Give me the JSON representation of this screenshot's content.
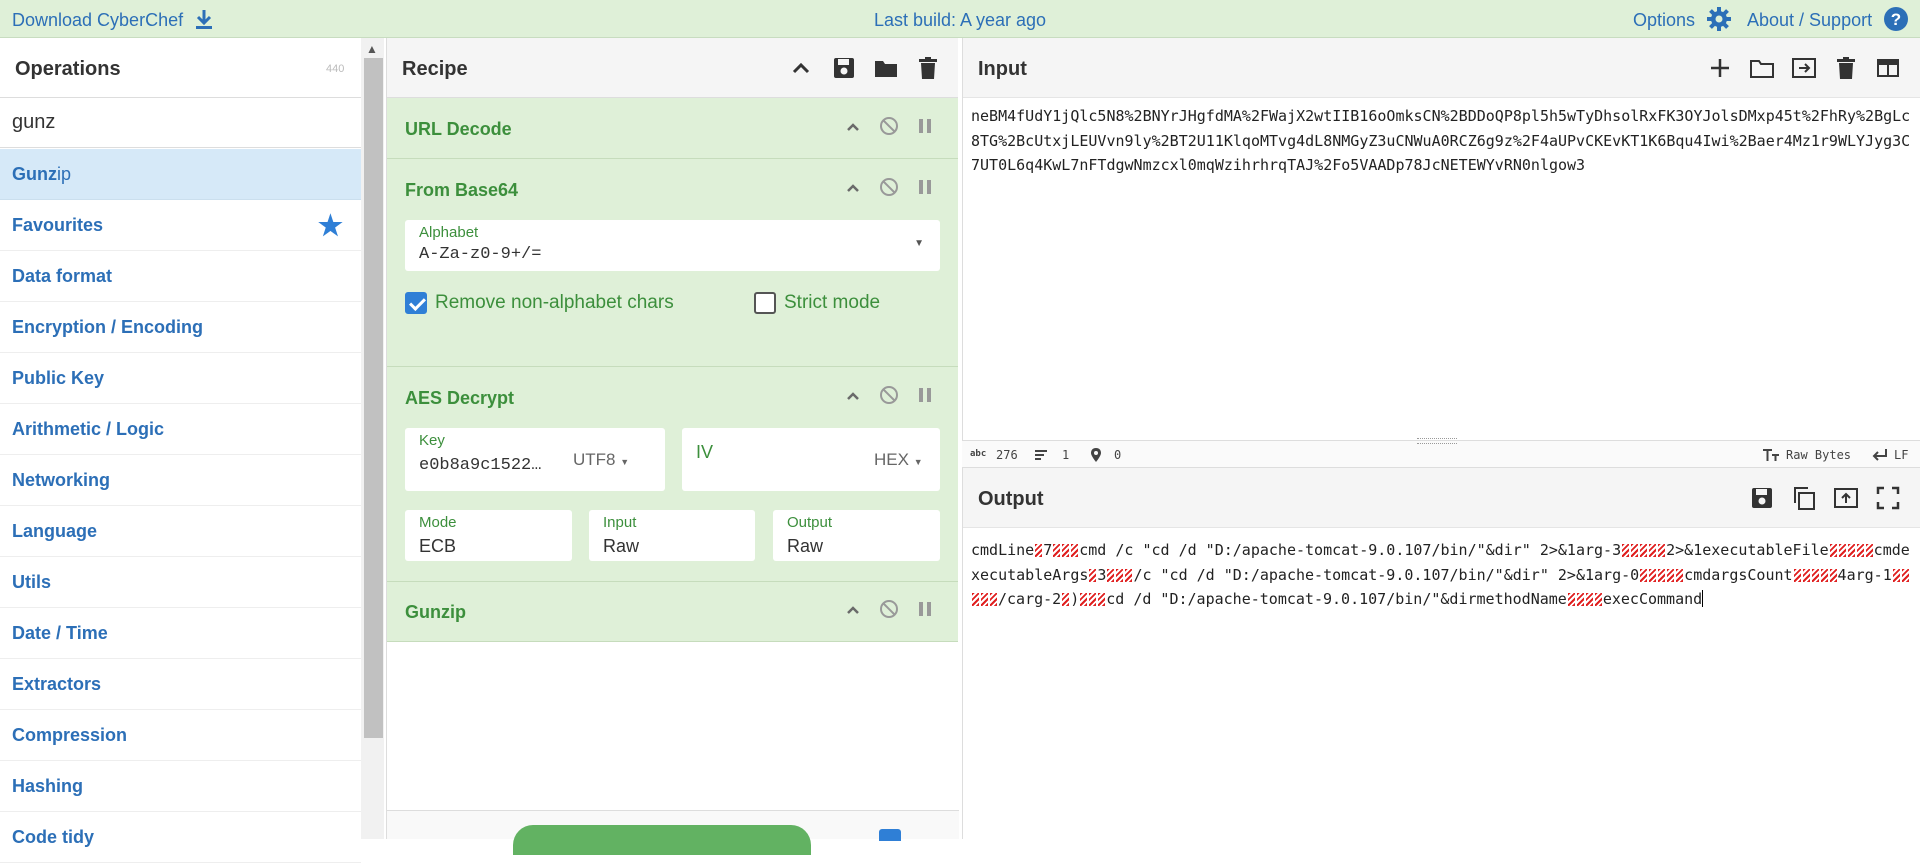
{
  "topbar": {
    "download": "Download CyberChef",
    "last_build": "Last build: A year ago",
    "options": "Options",
    "about": "About / Support"
  },
  "operations": {
    "title": "Operations",
    "count": "440",
    "search_value": "gunz",
    "result_match": "Gunz",
    "result_rest": "ip",
    "categories": [
      "Favourites",
      "Data format",
      "Encryption / Encoding",
      "Public Key",
      "Arithmetic / Logic",
      "Networking",
      "Language",
      "Utils",
      "Date / Time",
      "Extractors",
      "Compression",
      "Hashing",
      "Code tidy"
    ]
  },
  "recipe": {
    "title": "Recipe",
    "url_decode": "URL Decode",
    "from_base64": "From Base64",
    "alphabet_label": "Alphabet",
    "alphabet_value": "A-Za-z0-9+/=",
    "remove_nonalpha": "Remove non-alphabet chars",
    "strict_mode": "Strict mode",
    "aes_decrypt": "AES Decrypt",
    "key_label": "Key",
    "key_value": "e0b8a9c1522…",
    "key_encoding": "UTF8",
    "iv_label": "IV",
    "iv_encoding": "HEX",
    "mode_label": "Mode",
    "mode_value": "ECB",
    "input_label": "Input",
    "input_value": "Raw",
    "output_label": "Output",
    "output_value": "Raw",
    "gunzip": "Gunzip"
  },
  "input": {
    "title": "Input",
    "text": "neBM4fUdY1jQlc5N8%2BNYrJHgfdMA%2FWajX2wtIIB16oOmksCN%2BDDoQP8pl5h5wTyDhsolRxFK3OYJolsDMxp45t%2FhRy%2BgLc8TG%2BcUtxjLEUVvn9ly%2BT2U11KlqoMTvg4dL8NMGyZ3uCNWuA0RCZ6g9z%2F4aUPvCKEvKT1K6Bqu4Iwi%2Baer4Mz1r9WLYJyg3C7UT0L6q4KwL7nFTdgwNmzcxl0mqWzihrhrqTAJ%2Fo5VAADp78JcNETEWYvRN0nlgow3"
  },
  "status": {
    "chars_icon": "abc",
    "chars": "276",
    "lines": "1",
    "pos": "0",
    "raw_bytes": "Raw Bytes",
    "eol": "LF"
  },
  "output": {
    "title": "Output",
    "seg1": "cmdLine",
    "seg2": "7",
    "seg3": "cmd /c \"cd /d \"D:/apache-tomcat-9.0.107/bin/\"&dir\" 2>&1arg-3",
    "seg4": "2>&1executableFile",
    "seg5": "cmdexecutableArgs",
    "seg6": "3",
    "seg7": "/c \"cd /d \"D:/apache-tomcat-9.0.107/bin/\"&dir\" 2>&1arg-0",
    "seg8": "cmdargsCount",
    "seg9": "4arg-1",
    "seg10": "/carg-2",
    "seg11": ")",
    "seg12": "cd /d \"D:/apache-tomcat-9.0.107/bin/\"&dirmethodName",
    "seg13": "execCommand"
  },
  "colors": {
    "green_bg": "#dff0d8",
    "green_text": "#3c8f3c",
    "link_blue": "#2c6fb7",
    "selected_bg": "#d6e9f8"
  }
}
